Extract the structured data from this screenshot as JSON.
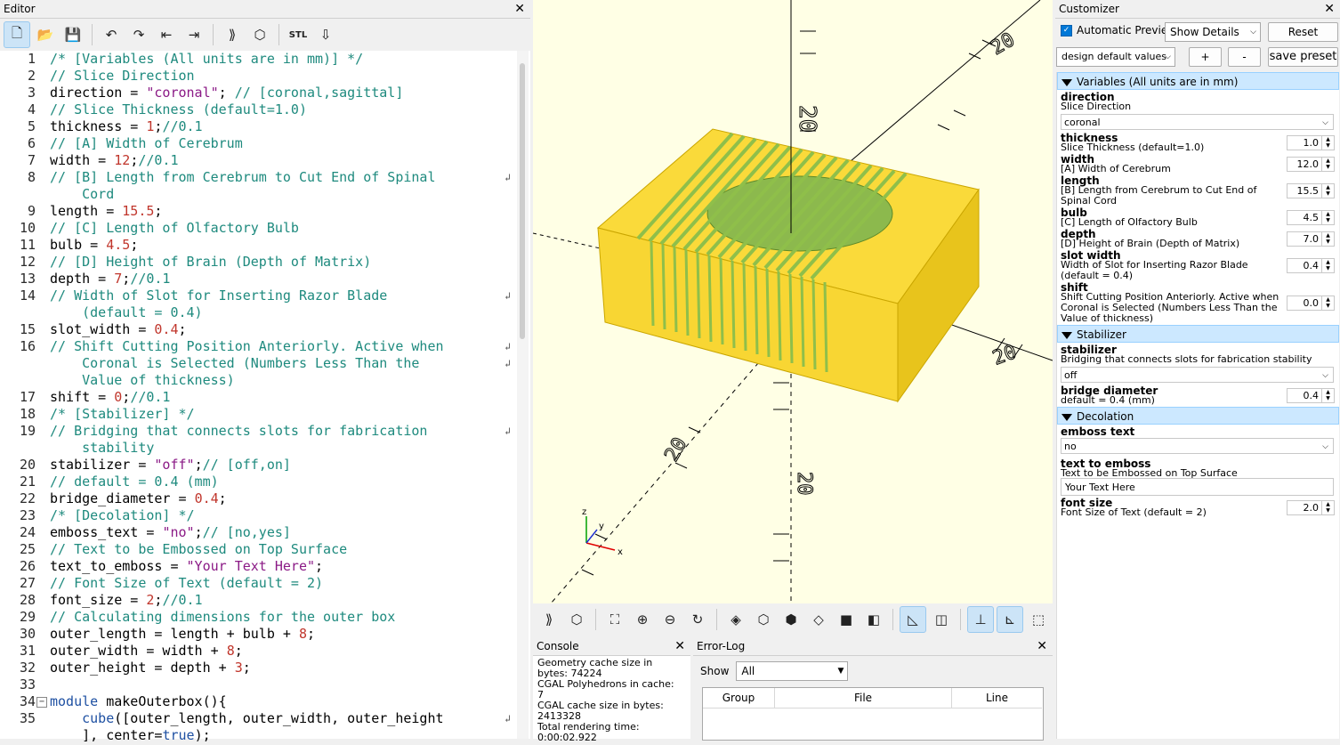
{
  "editor": {
    "title": "Editor",
    "close": "✕",
    "lines": [
      {
        "n": "1",
        "parts": [
          [
            "c-comment",
            "/* [Variables (All units are in mm)] */"
          ]
        ]
      },
      {
        "n": "2",
        "parts": [
          [
            "c-comment",
            "// Slice Direction"
          ]
        ]
      },
      {
        "n": "3",
        "parts": [
          [
            "",
            "direction = "
          ],
          [
            "c-str",
            "\"coronal\""
          ],
          [
            "",
            "; "
          ],
          [
            "c-comment",
            "// [coronal,sagittal]"
          ]
        ]
      },
      {
        "n": "4",
        "parts": [
          [
            "c-comment",
            "// Slice Thickness (default=1.0)"
          ]
        ]
      },
      {
        "n": "5",
        "parts": [
          [
            "",
            "thickness = "
          ],
          [
            "c-num",
            "1"
          ],
          [
            "",
            ";"
          ],
          [
            "c-comment",
            "//0.1"
          ]
        ]
      },
      {
        "n": "6",
        "parts": [
          [
            "c-comment",
            "// [A] Width of Cerebrum"
          ]
        ]
      },
      {
        "n": "7",
        "parts": [
          [
            "",
            "width = "
          ],
          [
            "c-num",
            "12"
          ],
          [
            "",
            ";"
          ],
          [
            "c-comment",
            "//0.1"
          ]
        ]
      },
      {
        "n": "8",
        "parts": [
          [
            "c-comment",
            "// [B] Length from Cerebrum to Cut End of Spinal"
          ]
        ],
        "wrap": true
      },
      {
        "n": "",
        "parts": [
          [
            "c-comment",
            "    Cord"
          ]
        ],
        "cont": true
      },
      {
        "n": "9",
        "parts": [
          [
            "",
            "length = "
          ],
          [
            "c-num",
            "15.5"
          ],
          [
            "",
            ";"
          ]
        ]
      },
      {
        "n": "10",
        "parts": [
          [
            "c-comment",
            "// [C] Length of Olfactory Bulb"
          ]
        ]
      },
      {
        "n": "11",
        "parts": [
          [
            "",
            "bulb = "
          ],
          [
            "c-num",
            "4.5"
          ],
          [
            "",
            ";"
          ]
        ]
      },
      {
        "n": "12",
        "parts": [
          [
            "c-comment",
            "// [D] Height of Brain (Depth of Matrix)"
          ]
        ]
      },
      {
        "n": "13",
        "parts": [
          [
            "",
            "depth = "
          ],
          [
            "c-num",
            "7"
          ],
          [
            "",
            ";"
          ],
          [
            "c-comment",
            "//0.1"
          ]
        ]
      },
      {
        "n": "14",
        "parts": [
          [
            "c-comment",
            "// Width of Slot for Inserting Razor Blade"
          ]
        ],
        "wrap": true
      },
      {
        "n": "",
        "parts": [
          [
            "c-comment",
            "    (default = 0.4)"
          ]
        ],
        "cont": true
      },
      {
        "n": "15",
        "parts": [
          [
            "",
            "slot_width = "
          ],
          [
            "c-num",
            "0.4"
          ],
          [
            "",
            ";"
          ]
        ]
      },
      {
        "n": "16",
        "parts": [
          [
            "c-comment",
            "// Shift Cutting Position Anteriorly. Active when"
          ]
        ],
        "wrap": true
      },
      {
        "n": "",
        "parts": [
          [
            "c-comment",
            "    Coronal is Selected (Numbers Less Than the"
          ]
        ],
        "cont": true,
        "wrap": true
      },
      {
        "n": "",
        "parts": [
          [
            "c-comment",
            "    Value of thickness)"
          ]
        ],
        "cont": true
      },
      {
        "n": "17",
        "parts": [
          [
            "",
            "shift = "
          ],
          [
            "c-num",
            "0"
          ],
          [
            "",
            ";"
          ],
          [
            "c-comment",
            "//0.1"
          ]
        ]
      },
      {
        "n": "18",
        "parts": [
          [
            "c-comment",
            "/* [Stabilizer] */"
          ]
        ]
      },
      {
        "n": "19",
        "parts": [
          [
            "c-comment",
            "// Bridging that connects slots for fabrication"
          ]
        ],
        "wrap": true
      },
      {
        "n": "",
        "parts": [
          [
            "c-comment",
            "    stability"
          ]
        ],
        "cont": true
      },
      {
        "n": "20",
        "parts": [
          [
            "",
            "stabilizer = "
          ],
          [
            "c-str",
            "\"off\""
          ],
          [
            "",
            ";"
          ],
          [
            "c-comment",
            "// [off,on]"
          ]
        ]
      },
      {
        "n": "21",
        "parts": [
          [
            "c-comment",
            "// default = 0.4 (mm)"
          ]
        ]
      },
      {
        "n": "22",
        "parts": [
          [
            "",
            "bridge_diameter = "
          ],
          [
            "c-num",
            "0.4"
          ],
          [
            "",
            ";"
          ]
        ]
      },
      {
        "n": "23",
        "parts": [
          [
            "c-comment",
            "/* [Decolation] */"
          ]
        ]
      },
      {
        "n": "24",
        "parts": [
          [
            "",
            "emboss_text = "
          ],
          [
            "c-str",
            "\"no\""
          ],
          [
            "",
            ";"
          ],
          [
            "c-comment",
            "// [no,yes]"
          ]
        ]
      },
      {
        "n": "25",
        "parts": [
          [
            "c-comment",
            "// Text to be Embossed on Top Surface"
          ]
        ]
      },
      {
        "n": "26",
        "parts": [
          [
            "",
            "text_to_emboss = "
          ],
          [
            "c-str",
            "\"Your Text Here\""
          ],
          [
            "",
            ";"
          ]
        ]
      },
      {
        "n": "27",
        "parts": [
          [
            "c-comment",
            "// Font Size of Text (default = 2)"
          ]
        ]
      },
      {
        "n": "28",
        "parts": [
          [
            "",
            "font_size = "
          ],
          [
            "c-num",
            "2"
          ],
          [
            "",
            ";"
          ],
          [
            "c-comment",
            "//0.1"
          ]
        ]
      },
      {
        "n": "29",
        "parts": [
          [
            "c-comment",
            "// Calculating dimensions for the outer box"
          ]
        ]
      },
      {
        "n": "30",
        "parts": [
          [
            "",
            "outer_length = length + bulb + "
          ],
          [
            "c-num",
            "8"
          ],
          [
            "",
            ";"
          ]
        ]
      },
      {
        "n": "31",
        "parts": [
          [
            "",
            "outer_width = width + "
          ],
          [
            "c-num",
            "8"
          ],
          [
            "",
            ";"
          ]
        ]
      },
      {
        "n": "32",
        "parts": [
          [
            "",
            "outer_height = depth + "
          ],
          [
            "c-num",
            "3"
          ],
          [
            "",
            ";"
          ]
        ]
      },
      {
        "n": "33",
        "parts": [
          [
            "",
            ""
          ]
        ]
      },
      {
        "n": "34",
        "parts": [
          [
            "c-kw",
            "module"
          ],
          [
            "",
            " makeOuterbox(){"
          ]
        ],
        "fold": true
      },
      {
        "n": "35",
        "parts": [
          [
            "",
            "    "
          ],
          [
            "c-kw",
            "cube"
          ],
          [
            "",
            "([outer_length, outer_width, outer_height"
          ]
        ],
        "wrap": true
      },
      {
        "n": "",
        "parts": [
          [
            "",
            "    ], center="
          ],
          [
            "c-kw",
            "true"
          ],
          [
            "",
            ");"
          ]
        ],
        "cont": true
      }
    ]
  },
  "viewport": {
    "axis_labels": [
      "20",
      "20",
      "20",
      "20",
      "20"
    ],
    "gizmo": {
      "z": "z",
      "y": "y",
      "x": "x"
    }
  },
  "console": {
    "title": "Console",
    "close": "✕",
    "lines": [
      "Geometry cache size in",
      "bytes: 74224",
      "CGAL Polyhedrons in cache:",
      "7",
      "CGAL cache size in bytes:",
      "2413328",
      "Total rendering time:",
      "0:00:02.922"
    ]
  },
  "errorlog": {
    "title": "Error-Log",
    "close": "✕",
    "show_label": "Show",
    "show_value": "All",
    "columns": [
      "Group",
      "File",
      "Line"
    ]
  },
  "customizer": {
    "title": "Customizer",
    "close": "✕",
    "auto_preview": "Automatic Preview",
    "show_details": "Show Details",
    "reset": "Reset",
    "preset": "design default values",
    "plus": "+",
    "minus": "-",
    "save_preset": "save preset",
    "sections": {
      "variables": "Variables (All units are in mm)",
      "stabilizer": "Stabilizer",
      "decolation": "Decolation"
    },
    "params": {
      "direction": {
        "name": "direction",
        "desc": "Slice Direction",
        "value": "coronal"
      },
      "thickness": {
        "name": "thickness",
        "desc": "Slice Thickness (default=1.0)",
        "value": "1.0"
      },
      "width": {
        "name": "width",
        "desc": "[A] Width of Cerebrum",
        "value": "12.0"
      },
      "length": {
        "name": "length",
        "desc": "[B] Length from Cerebrum to Cut End of Spinal Cord",
        "value": "15.5"
      },
      "bulb": {
        "name": "bulb",
        "desc": "[C] Length of Olfactory Bulb",
        "value": "4.5"
      },
      "depth": {
        "name": "depth",
        "desc": "[D] Height of Brain (Depth of Matrix)",
        "value": "7.0"
      },
      "slot_width": {
        "name": "slot width",
        "desc": "Width of Slot for Inserting Razor Blade (default = 0.4)",
        "value": "0.4"
      },
      "shift": {
        "name": "shift",
        "desc": "Shift Cutting Position Anteriorly. Active when Coronal is Selected (Numbers Less Than the Value of thickness)",
        "value": "0.0"
      },
      "stabilizer": {
        "name": "stabilizer",
        "desc": "Bridging that connects slots for fabrication stability",
        "value": "off"
      },
      "bridge_diameter": {
        "name": "bridge diameter",
        "desc": "default = 0.4 (mm)",
        "value": "0.4"
      },
      "emboss_text": {
        "name": "emboss text",
        "value": "no"
      },
      "text_to_emboss": {
        "name": "text to emboss",
        "desc": "Text to be Embossed on Top Surface",
        "value": "Your Text Here"
      },
      "font_size": {
        "name": "font size",
        "desc": "Font Size of Text (default = 2)",
        "value": "2.0"
      }
    }
  },
  "colors": {
    "model_yellow": "#f8d633",
    "model_side": "#e8c41c",
    "slot_green": "#8fbf4a",
    "viewport_bg": "#ffffe5",
    "accent": "#0078d7"
  }
}
